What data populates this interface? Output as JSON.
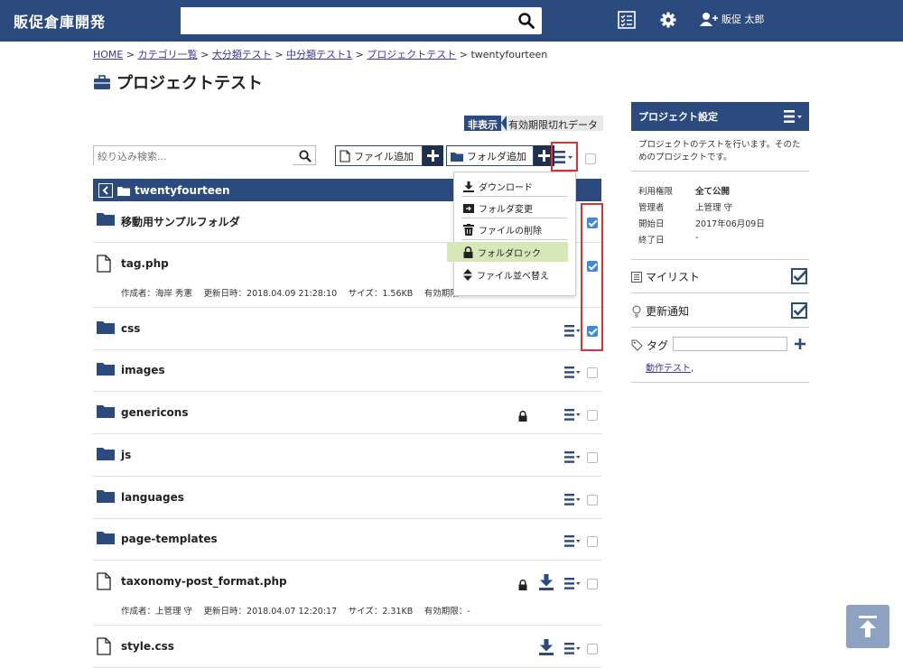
{
  "header": {
    "brand": "販促倉庫開発",
    "search_placeholder": "",
    "user_name": "販促 太郎"
  },
  "breadcrumb": {
    "items": [
      "HOME",
      "カテゴリ一覧",
      "大分類テスト",
      "中分類テスト1",
      "プロジェクトテスト"
    ],
    "current": "twentyfourteen",
    "separator": ">"
  },
  "page_title": "プロジェクトテスト",
  "hidden_badge": {
    "label": "非表示",
    "text": "有効期限切れデータ"
  },
  "toolbar": {
    "filter_placeholder": "絞り込み検索...",
    "add_file": "ファイル追加",
    "add_folder": "フォルダ追加"
  },
  "current_folder": "twentyfourteen",
  "dropdown": {
    "items": [
      {
        "label": "ダウンロード",
        "icon": "download-icon"
      },
      {
        "label": "フォルダ変更",
        "icon": "folder-move-icon"
      },
      {
        "label": "ファイルの削除",
        "icon": "trash-icon"
      },
      {
        "label": "フォルダロック",
        "icon": "lock-icon"
      },
      {
        "label": "ファイル並べ替え",
        "icon": "sort-icon"
      }
    ]
  },
  "rows": [
    {
      "name": "移動用サンプルフォルダ",
      "type": "folder",
      "checked": true,
      "locked": false,
      "download": false,
      "meta": ""
    },
    {
      "name": "tag.php",
      "type": "file",
      "checked": true,
      "locked": false,
      "download": false,
      "meta": "作成者：海岸 秀憲　 更新日時：2018.04.09 21:28:10　 サイズ：1.56KB　 有効期限"
    },
    {
      "name": "css",
      "type": "folder",
      "checked": true,
      "locked": false,
      "download": false,
      "meta": ""
    },
    {
      "name": "images",
      "type": "folder",
      "checked": false,
      "locked": false,
      "download": false,
      "meta": ""
    },
    {
      "name": "genericons",
      "type": "folder",
      "checked": false,
      "locked": true,
      "download": false,
      "meta": ""
    },
    {
      "name": "js",
      "type": "folder",
      "checked": false,
      "locked": false,
      "download": false,
      "meta": ""
    },
    {
      "name": "languages",
      "type": "folder",
      "checked": false,
      "locked": false,
      "download": false,
      "meta": ""
    },
    {
      "name": "page-templates",
      "type": "folder",
      "checked": false,
      "locked": false,
      "download": false,
      "meta": ""
    },
    {
      "name": "taxonomy-post_format.php",
      "type": "file",
      "checked": false,
      "locked": true,
      "download": true,
      "meta": "作成者：上管理 守　 更新日時：2018.04.07 12:20:17　 サイズ：2.31KB　 有効期限：-"
    },
    {
      "name": "style.css",
      "type": "file",
      "checked": false,
      "locked": false,
      "download": true,
      "meta": ""
    }
  ],
  "sidebar": {
    "title": "プロジェクト設定",
    "description": "プロジェクトのテストを行います。そのためのプロジェクトです。",
    "info": [
      {
        "label": "利用権限",
        "value": "全て公開",
        "bold": true
      },
      {
        "label": "管理者",
        "value": "上管理 守",
        "bold": false
      },
      {
        "label": "開始日",
        "value": "2017年06月09日",
        "bold": false
      },
      {
        "label": "終了日",
        "value": "-",
        "bold": false
      }
    ],
    "mylist": "マイリスト",
    "notify": "更新通知",
    "tag_label": "タグ",
    "tag_link": "動作テスト",
    "tag_suffix": ","
  },
  "colors": {
    "primary": "#2b4a7e",
    "dark": "#1e2f4f",
    "highlight": "#d6e8b8",
    "red": "#e03030",
    "check": "#3d8be0"
  }
}
